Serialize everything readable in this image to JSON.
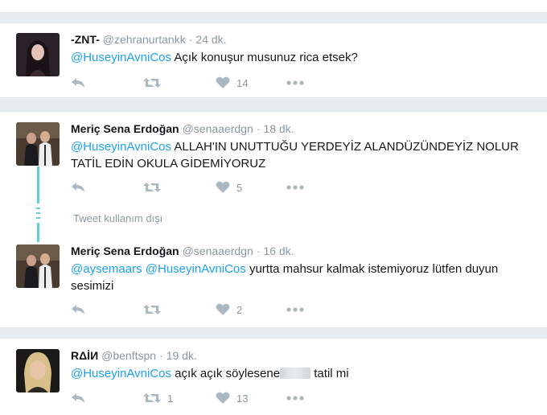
{
  "tweets": [
    {
      "name": "-ZNT-",
      "handle": "@zehranurtankk",
      "time": "24 dk.",
      "mention1": "@HuseyinAvniCos",
      "text": " Açık konuşur musunuz rica etsek?",
      "retweets": "",
      "likes": "14"
    },
    {
      "name": "Meriç Sena Erdoğan",
      "handle": "@senaaerdgn",
      "time": "18 dk.",
      "mention1": "@HuseyinAvniCos",
      "text": " ALLAH'IN UNUTTUĞU YERDEYİZ ALANDÜZÜNDEYİZ NOLUR TATİL EDİN OKULA GİDEMİYORUZ",
      "retweets": "",
      "likes": "5"
    },
    {
      "name": "Meriç Sena Erdoğan",
      "handle": "@senaaerdgn",
      "time": "16 dk.",
      "mention1": "@aysemaars",
      "mention2": "@HuseyinAvniCos",
      "text": " yurtta mahsur kalmak istemiyoruz lütfen duyun sesimizi",
      "retweets": "",
      "likes": "2"
    },
    {
      "name": "RΔİИ",
      "handle": "@benftspn",
      "time": "19 dk.",
      "mention1": "@HuseyinAvniCos",
      "text_before": " açık açık söylesene",
      "text_after": " tatil mi",
      "retweets": "1",
      "likes": "13"
    }
  ],
  "unavailable_text": "Tweet kullanım dışı",
  "separator": "·",
  "colors": {
    "accent": "#1da1f2",
    "thread": "#5ed0d8",
    "muted": "#8899a6",
    "background": "#e6ecf0"
  },
  "icons": [
    "reply-icon",
    "retweet-icon",
    "heart-icon",
    "more-icon"
  ]
}
